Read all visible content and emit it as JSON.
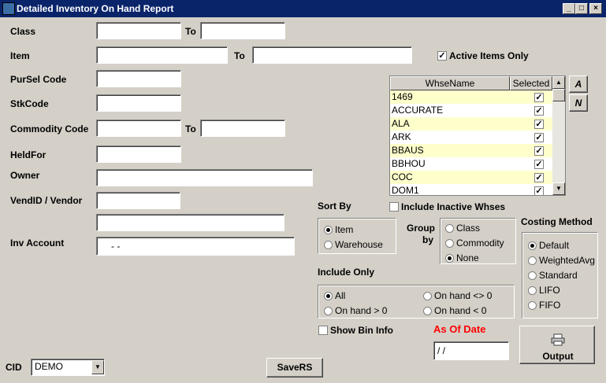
{
  "window": {
    "title": "Detailed Inventory On Hand Report",
    "min": "_",
    "max": "□",
    "close": "×"
  },
  "filters": {
    "class_label": "Class",
    "to1": "To",
    "item_label": "Item",
    "to2": "To",
    "pursel_label": "PurSel Code",
    "stk_label": "StkCode",
    "commodity_label": "Commodity Code",
    "to3": "To",
    "heldfor_label": "HeldFor",
    "owner_label": "Owner",
    "vendor_label": "VendID / Vendor",
    "invaccount_label": "Inv Account",
    "invaccount_value": "-  -"
  },
  "active_items": {
    "label": "Active Items Only",
    "checked": "✓"
  },
  "warehouse_grid": {
    "col_name": "WhseName",
    "col_selected": "Selected",
    "rows": [
      {
        "name": "1469",
        "sel": "✓"
      },
      {
        "name": "ACCURATE",
        "sel": "✓"
      },
      {
        "name": "ALA",
        "sel": "✓"
      },
      {
        "name": "ARK",
        "sel": "✓"
      },
      {
        "name": "BBAUS",
        "sel": "✓"
      },
      {
        "name": "BBHOU",
        "sel": "✓"
      },
      {
        "name": "COC",
        "sel": "✓"
      },
      {
        "name": "DOM1",
        "sel": "✓"
      }
    ],
    "btn_all": "A",
    "btn_none": "N"
  },
  "include_inactive": {
    "label": "Include Inactive Whses"
  },
  "sort_by": {
    "label": "Sort By",
    "item": "Item",
    "warehouse": "Warehouse"
  },
  "group_by": {
    "label1": "Group",
    "label2": "by",
    "class": "Class",
    "commodity": "Commodity",
    "none": "None"
  },
  "costing": {
    "label": "Costing Method",
    "default": "Default",
    "weighted": "WeightedAvg",
    "standard": "Standard",
    "lifo": "LIFO",
    "fifo": "FIFO"
  },
  "include_only": {
    "label": "Include Only",
    "all": "All",
    "on_hand_ne": "On hand <> 0",
    "on_hand_gt": "On hand > 0",
    "on_hand_lt": "On hand < 0"
  },
  "show_bin": {
    "label": "Show Bin Info"
  },
  "as_of": {
    "label": "As Of Date",
    "value": "/ /"
  },
  "output": {
    "label": "Output"
  },
  "saverse": {
    "label": "SaveRS"
  },
  "cid": {
    "label": "CID",
    "value": "DEMO"
  }
}
